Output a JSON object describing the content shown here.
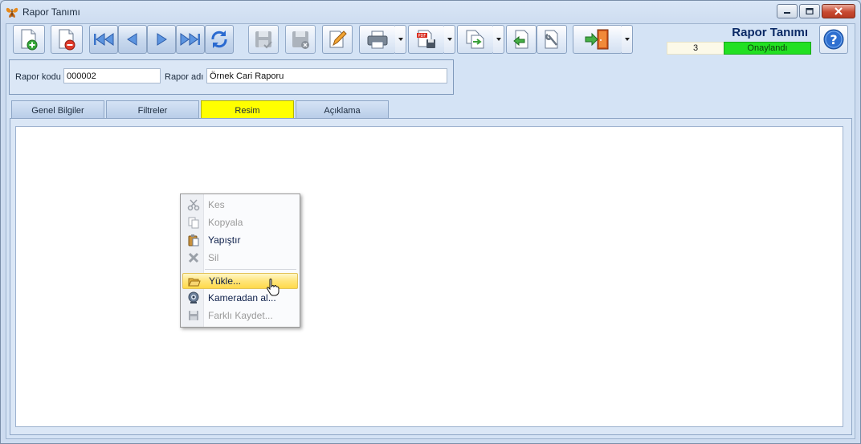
{
  "window": {
    "title": "Rapor Tanımı"
  },
  "header": {
    "title": "Rapor Tanımı",
    "record_number": "3",
    "status": "Onaylandı"
  },
  "toolbar": {
    "buttons": [
      "new-record-icon",
      "delete-record-icon",
      "first-record-icon",
      "previous-record-icon",
      "next-record-icon",
      "last-record-icon",
      "refresh-icon",
      "save-icon",
      "cancel-save-icon",
      "edit-icon",
      "print-icon",
      "pdf-export-icon",
      "copy-record-icon",
      "import-icon",
      "settings-icon",
      "exit-icon",
      "help-icon"
    ]
  },
  "fields": {
    "rapor_kodu_label": "Rapor kodu",
    "rapor_kodu_value": "000002",
    "rapor_adi_label": "Rapor adı",
    "rapor_adi_value": "Örnek Cari Raporu"
  },
  "tabs": [
    {
      "label": "Genel Bilgiler",
      "active": false
    },
    {
      "label": "Filtreler",
      "active": false
    },
    {
      "label": "Resim",
      "active": true
    },
    {
      "label": "Açıklama",
      "active": false
    }
  ],
  "context_menu": {
    "items": [
      {
        "label": "Kes",
        "icon": "scissors-icon",
        "enabled": false
      },
      {
        "label": "Kopyala",
        "icon": "copy-icon",
        "enabled": false
      },
      {
        "label": "Yapıştır",
        "icon": "paste-icon",
        "enabled": true
      },
      {
        "label": "Sil",
        "icon": "delete-x-icon",
        "enabled": false
      },
      {
        "label": "Yükle...",
        "icon": "folder-open-icon",
        "enabled": true,
        "highlighted": true
      },
      {
        "label": "Kameradan al...",
        "icon": "webcam-icon",
        "enabled": true
      },
      {
        "label": "Farklı Kaydet...",
        "icon": "save-as-icon",
        "enabled": false
      }
    ]
  },
  "colors": {
    "active_tab": "#ffff00",
    "status_approved": "#22e022",
    "menu_highlight": "#ffe57a"
  }
}
